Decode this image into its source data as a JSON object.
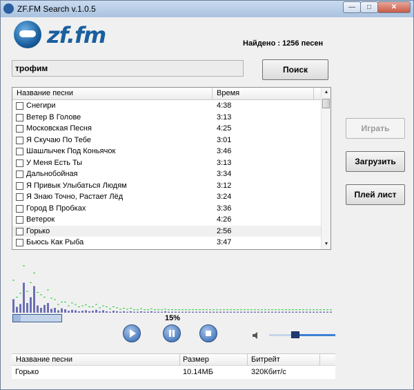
{
  "window": {
    "title": "ZF.FM Search v.1.0.5",
    "minimize_label": "—",
    "maximize_label": "□",
    "close_label": "✕"
  },
  "logo": {
    "text": "zf.fm"
  },
  "found_text": "Найдено : 1256 песен",
  "search": {
    "value": "трофим",
    "button_label": "Поиск"
  },
  "songlist": {
    "col_name": "Название песни",
    "col_time": "Время",
    "rows": [
      {
        "name": "Снегири",
        "time": "4:38"
      },
      {
        "name": "Ветер В Голове",
        "time": "3:13"
      },
      {
        "name": "Московская Песня",
        "time": "4:25"
      },
      {
        "name": "Я Скучаю По Тебе",
        "time": "3:01"
      },
      {
        "name": "Шашлычек Под Коньячок",
        "time": "3:46"
      },
      {
        "name": "У Меня Есть Ты",
        "time": "3:13"
      },
      {
        "name": "Дальнобойная",
        "time": "3:34"
      },
      {
        "name": "Я Привык Улыбаться Людям",
        "time": "3:12"
      },
      {
        "name": "Я Знаю Точно, Растает Лёд",
        "time": "3:24"
      },
      {
        "name": "Город В Пробках",
        "time": "3:36"
      },
      {
        "name": "Ветерок",
        "time": "4:26"
      },
      {
        "name": "Горько",
        "time": "2:56"
      },
      {
        "name": "Бьюсь Как Рыба",
        "time": "3:47"
      }
    ],
    "selected_index": 11
  },
  "side_buttons": {
    "play_label": "Играть",
    "load_label": "Загрузить",
    "playlist_label": "Плей лист"
  },
  "progress": {
    "percent_text": "15%",
    "fraction": 0.15
  },
  "volume": {
    "fraction": 0.38
  },
  "icons": {
    "app": "zf-logo-icon",
    "play": "play-icon",
    "pause": "pause-icon",
    "stop": "stop-icon",
    "volume": "speaker-icon"
  },
  "colors": {
    "accent": "#1a5f9e",
    "bar": "#6b6fb5",
    "peak": "#22cc33"
  },
  "spectrum": {
    "bars": [
      0.28,
      0.12,
      0.18,
      0.62,
      0.2,
      0.32,
      0.55,
      0.15,
      0.1,
      0.16,
      0.2,
      0.08,
      0.1,
      0.05,
      0.09,
      0.07,
      0.04,
      0.06,
      0.05,
      0.03,
      0.04,
      0.05,
      0.03,
      0.04,
      0.06,
      0.03,
      0.05,
      0.03,
      0.02,
      0.04,
      0.03,
      0.02,
      0.03,
      0.02,
      0.03,
      0.02,
      0.02,
      0.03,
      0.02,
      0.02,
      0.03,
      0.02,
      0.02,
      0.02,
      0.03,
      0.02,
      0.02,
      0.02,
      0.02,
      0.02,
      0.02,
      0.02,
      0.02,
      0.02,
      0.02,
      0.02,
      0.02,
      0.02,
      0.02,
      0.02,
      0.02,
      0.02,
      0.02,
      0.02,
      0.02,
      0.02,
      0.02,
      0.02,
      0.02,
      0.02,
      0.02,
      0.02,
      0.02,
      0.02,
      0.02,
      0.02,
      0.02,
      0.02,
      0.02,
      0.02,
      0.02,
      0.02,
      0.02,
      0.02,
      0.02,
      0.02,
      0.02,
      0.02,
      0.02,
      0.02,
      0.02,
      0.02,
      0.02
    ],
    "peaks": [
      0.65,
      0.3,
      0.38,
      0.95,
      0.42,
      0.6,
      0.8,
      0.4,
      0.35,
      0.3,
      0.45,
      0.28,
      0.25,
      0.15,
      0.2,
      0.2,
      0.12,
      0.18,
      0.15,
      0.1,
      0.12,
      0.14,
      0.1,
      0.1,
      0.15,
      0.08,
      0.12,
      0.1,
      0.06,
      0.1,
      0.08,
      0.05,
      0.07,
      0.05,
      0.07,
      0.04,
      0.04,
      0.06,
      0.04,
      0.04,
      0.06,
      0.04,
      0.04,
      0.04,
      0.05,
      0.04,
      0.04,
      0.04,
      0.04,
      0.04,
      0.04,
      0.04,
      0.04,
      0.04,
      0.04,
      0.04,
      0.04,
      0.04,
      0.04,
      0.04,
      0.04,
      0.04,
      0.04,
      0.04,
      0.04,
      0.04,
      0.04,
      0.04,
      0.04,
      0.04,
      0.04,
      0.04,
      0.04,
      0.04,
      0.04,
      0.04,
      0.04,
      0.04,
      0.04,
      0.04,
      0.04,
      0.04,
      0.04,
      0.04,
      0.04,
      0.04,
      0.04,
      0.04,
      0.04,
      0.04,
      0.04,
      0.04,
      0.04
    ]
  },
  "download": {
    "col_name": "Название песни",
    "col_size": "Размер",
    "col_bitrate": "Битрейт",
    "row": {
      "name": "Горько",
      "size": "10.14МБ",
      "bitrate": "320Кбит/с"
    }
  }
}
